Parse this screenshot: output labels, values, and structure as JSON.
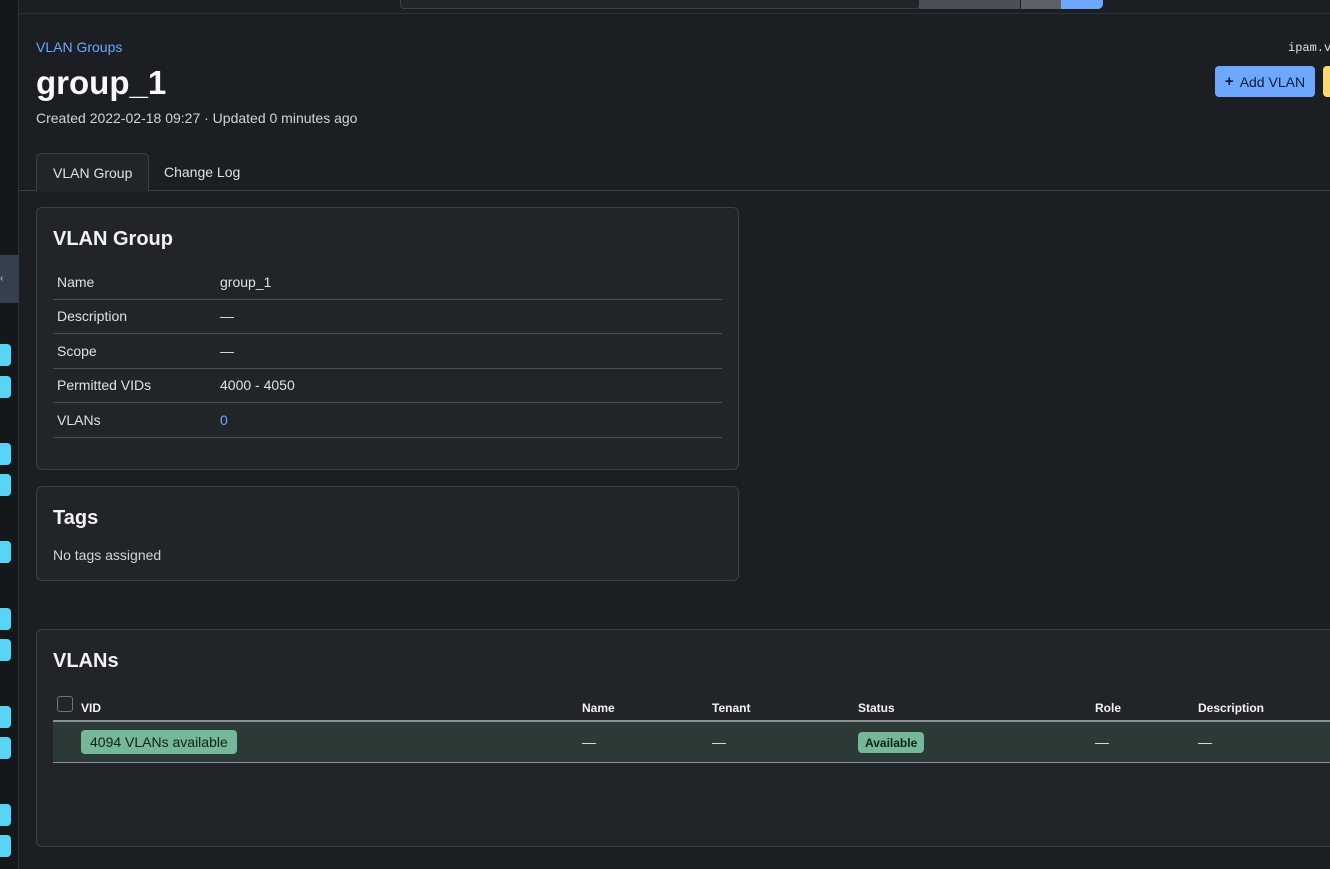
{
  "breadcrumb": "VLAN Groups",
  "object_id": "ipam.vlangroup:1",
  "title": "group_1",
  "meta": "Created 2022-02-18 09:27 · Updated 0 minutes ago",
  "actions": {
    "add_vlan": "Add VLAN",
    "add_icon": "+"
  },
  "tabs": [
    {
      "label": "VLAN Group",
      "active": true
    },
    {
      "label": "Change Log",
      "active": false
    }
  ],
  "vlan_group_card": {
    "title": "VLAN Group",
    "rows": [
      {
        "key": "Name",
        "value": "group_1"
      },
      {
        "key": "Description",
        "value": "—"
      },
      {
        "key": "Scope",
        "value": "—"
      },
      {
        "key": "Permitted VIDs",
        "value": "4000 - 4050"
      },
      {
        "key": "VLANs",
        "value": "0"
      }
    ]
  },
  "tags_card": {
    "title": "Tags",
    "empty": "No tags assigned"
  },
  "vlans_card": {
    "title": "VLANs",
    "columns": [
      "VID",
      "Name",
      "Tenant",
      "Status",
      "Role",
      "Description"
    ],
    "row": {
      "available": "4094 VLANs available",
      "name": "—",
      "tenant": "—",
      "status": "Available",
      "role": "—",
      "description": "—"
    }
  },
  "colors": {
    "accent": "#6ea8fe",
    "success": "#75b798",
    "warning": "#ffda6a",
    "sidebar_pill": "#5ad4f5",
    "background": "#1b1f23",
    "card": "#212529"
  }
}
